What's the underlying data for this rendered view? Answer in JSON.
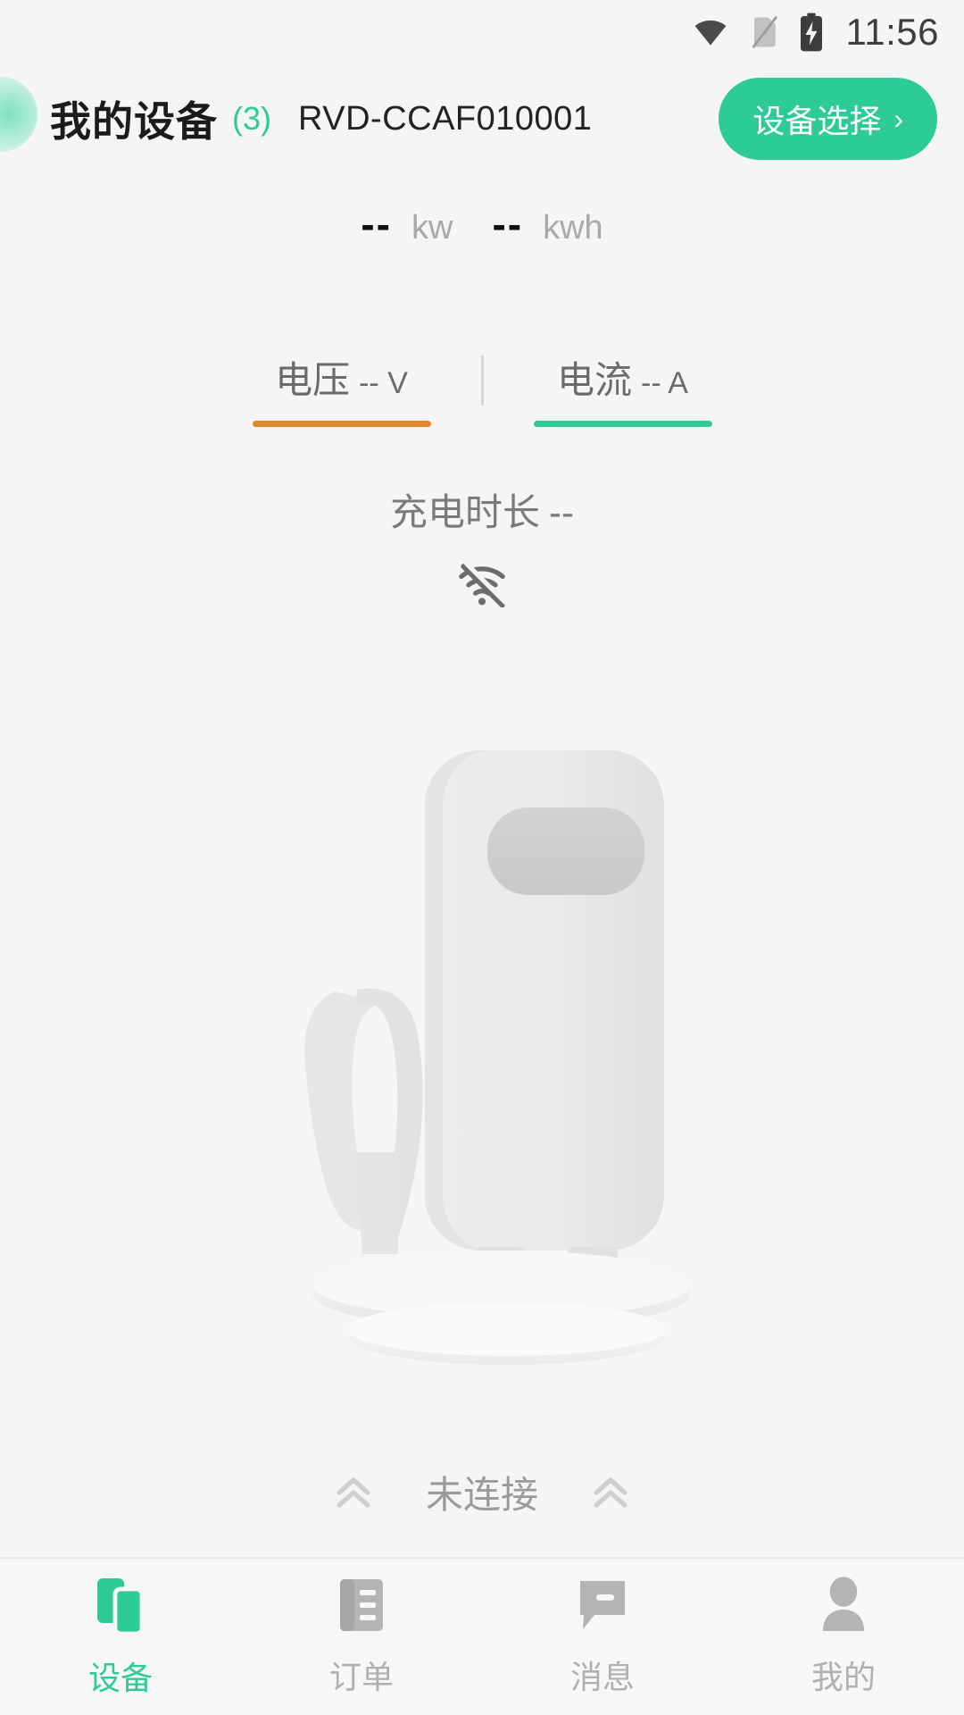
{
  "statusbar": {
    "time": "11:56",
    "icons": [
      "wifi-icon",
      "sim-card-off-icon",
      "battery-charging-icon"
    ]
  },
  "header": {
    "title": "我的设备",
    "count": "(3)",
    "serial": "RVD-CCAF010001",
    "select_button": "设备选择",
    "chevron": "›",
    "accent_color": "#2ecc95"
  },
  "metrics": [
    {
      "value": "--",
      "unit": "kw"
    },
    {
      "value": "--",
      "unit": "kwh"
    }
  ],
  "tabs": [
    {
      "name": "电压",
      "value": "-- V",
      "underline_color": "#e2852c"
    },
    {
      "name": "电流",
      "value": "-- A",
      "underline_color": "#2ecc95"
    }
  ],
  "duration": {
    "label": "充电时长",
    "value": "--"
  },
  "network": {
    "icon": "wifi-off-icon"
  },
  "device_image": {
    "name": "ev-charger-illustration"
  },
  "connection": {
    "status": "未连接",
    "left_icon": "chevron-double-up-icon",
    "right_icon": "chevron-double-up-icon"
  },
  "bottomnav": {
    "items": [
      {
        "label": "设备",
        "icon": "device-icon",
        "active": true
      },
      {
        "label": "订单",
        "icon": "order-list-icon",
        "active": false
      },
      {
        "label": "消息",
        "icon": "message-icon",
        "active": false
      },
      {
        "label": "我的",
        "icon": "profile-person-icon",
        "active": false
      }
    ],
    "active_color": "#2ecc95",
    "inactive_color": "#b0b0b0"
  }
}
